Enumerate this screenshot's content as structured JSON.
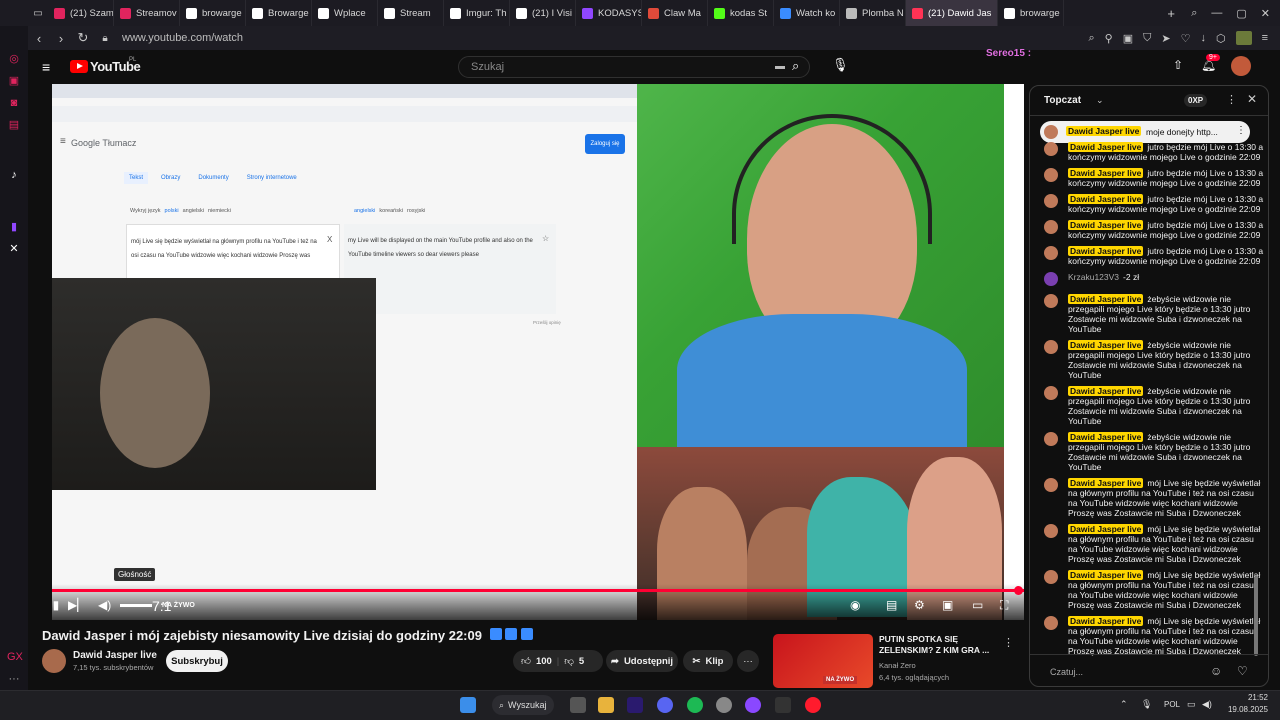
{
  "browser": {
    "tabs": [
      {
        "label": "(21) Szam",
        "color": "#e0245e"
      },
      {
        "label": "Streamov",
        "color": "#e0245e"
      },
      {
        "label": "browarge",
        "color": "#ffffff"
      },
      {
        "label": "Browarge",
        "color": "#ffffff"
      },
      {
        "label": "Wplace",
        "color": "#ffffff"
      },
      {
        "label": "Stream",
        "color": "#ffffff"
      },
      {
        "label": "Imgur: Th",
        "color": "#ffffff"
      },
      {
        "label": "(21) I Visi",
        "color": "#ffffff"
      },
      {
        "label": "KODASYSL Purchase",
        "color": "#9147ff"
      },
      {
        "label": "Claw Ma",
        "color": "#e04a3a"
      },
      {
        "label": "kodas St",
        "color": "#53fc18"
      },
      {
        "label": "Watch ko",
        "color": "#3a8cff"
      },
      {
        "label": "Plomba N",
        "color": "#bbbbbb"
      },
      {
        "label": "(21) Dawid Jas",
        "color": "#ff3355",
        "active": true
      },
      {
        "label": "browarge",
        "color": "#ffffff"
      }
    ],
    "new_tab": "+",
    "url": "www.youtube.com/watch",
    "user": "Sereo15 :"
  },
  "yt": {
    "logo": "YouTube",
    "region": "PL",
    "search_placeholder": "Szukaj",
    "notifications": "9+"
  },
  "video": {
    "screen_share": {
      "app_name": "Google Tłumacz",
      "signin": "Zaloguj się",
      "mode_tabs": [
        "Tekst",
        "Obrazy",
        "Dokumenty",
        "Strony internetowe"
      ],
      "src_langs": [
        "Wykryj język",
        "polski",
        "angielski",
        "niemiecki"
      ],
      "dst_langs": [
        "angielski",
        "koreański",
        "rosyjski"
      ],
      "source_text": "mój Live się będzie wyświetlał na głównym profilu na YouTube i też na osi czasu na YouTube widzowie więc kochani widzowie Proszę was",
      "translation": "my Live will be displayed on the main YouTube profile and also on the YouTube timeline viewers so dear viewers please",
      "close_x": "X",
      "send_feedback": "Prześlij opinię"
    },
    "tooltip": "Głośność",
    "live_badge": "NA ŻYWO",
    "time_partial": "7:1"
  },
  "chat": {
    "title": "Topczat",
    "points": "0XP",
    "pinned": {
      "name": "Dawid Jasper live",
      "text": "moje donejty http..."
    },
    "messages": [
      {
        "name": "Dawid Jasper live",
        "text": "jutro będzie mój Live o 13:30 a kończymy widzownie mojego Live o godzinie 22:09"
      },
      {
        "name": "Dawid Jasper live",
        "text": "jutro będzie mój Live o 13:30 a kończymy widzownie mojego Live o godzinie 22:09"
      },
      {
        "name": "Dawid Jasper live",
        "text": "jutro będzie mój Live o 13:30 a kończymy widzownie mojego Live o godzinie 22:09"
      },
      {
        "name": "Dawid Jasper live",
        "text": "jutro będzie mój Live o 13:30 a kończymy widzownie mojego Live o godzinie 22:09"
      },
      {
        "name": "Dawid Jasper live",
        "text": "jutro będzie mój Live o 13:30 a kończymy widzownie mojego Live o godzinie 22:09"
      },
      {
        "name": "Krzaku123V3",
        "text": "-2 zł",
        "plain": true
      },
      {
        "name": "Dawid Jasper live",
        "text": "żebyście widzowie nie przegapili mojego Live który będzie o 13:30 jutro Zostawcie mi widzowie Suba i dzwoneczek na YouTube"
      },
      {
        "name": "Dawid Jasper live",
        "text": "żebyście widzowie nie przegapili mojego Live który będzie o 13:30 jutro Zostawcie mi widzowie Suba i dzwoneczek na YouTube"
      },
      {
        "name": "Dawid Jasper live",
        "text": "żebyście widzowie nie przegapili mojego Live który będzie o 13:30 jutro Zostawcie mi widzowie Suba i dzwoneczek na YouTube"
      },
      {
        "name": "Dawid Jasper live",
        "text": "żebyście widzowie nie przegapili mojego Live który będzie o 13:30 jutro Zostawcie mi widzowie Suba i dzwoneczek na YouTube"
      },
      {
        "name": "Dawid Jasper live",
        "text": "mój Live się będzie wyświetlał na głównym profilu na YouTube i też na osi czasu na YouTube widzowie więc kochani widzowie Proszę was Zostawcie mi Suba i Dzwoneczek"
      },
      {
        "name": "Dawid Jasper live",
        "text": "mój Live się będzie wyświetlał na głównym profilu na YouTube i też na osi czasu na YouTube widzowie więc kochani widzowie Proszę was Zostawcie mi Suba i Dzwoneczek"
      },
      {
        "name": "Dawid Jasper live",
        "text": "mój Live się będzie wyświetlał na głównym profilu na YouTube i też na osi czasu na YouTube widzowie więc kochani widzowie Proszę was Zostawcie mi Suba i Dzwoneczek"
      },
      {
        "name": "Dawid Jasper live",
        "text": "mój Live się będzie wyświetlał na głównym profilu na YouTube i też na osi czasu na YouTube widzowie więc kochani widzowie Proszę was Zostawcie mi Suba i Dzwoneczek"
      }
    ],
    "input_placeholder": "Czatuj..."
  },
  "below": {
    "title": "Dawid Jasper i mój zajebisty niesamowity Live dzisiaj do godziny 22:09",
    "channel": "Dawid Jasper live",
    "subs": "7,15 tys. subskrybentów",
    "subscribe": "Subskrybuj",
    "likes": "100",
    "dislikes": "5",
    "share": "Udostępnij",
    "clip": "Klip",
    "more": "···",
    "rec": {
      "title": "PUTIN SPOTKA SIĘ ZELENSKIM? Z KIM GRA ...",
      "channel": "Kanał Zero",
      "watching": "6,4 tys. oglądających",
      "thumb_badge": "NA ŻYWO"
    }
  },
  "taskbar": {
    "search": "Wyszukaj",
    "lang": "POL",
    "time": "21:52",
    "date": "19.08.2025"
  }
}
